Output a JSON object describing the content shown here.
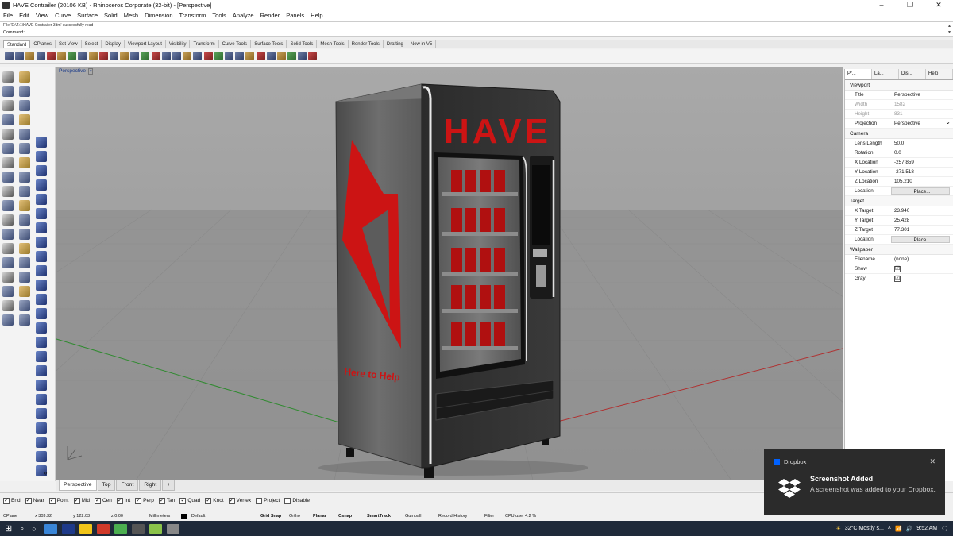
{
  "window": {
    "title": "HAVE Contrailer (20106 KB) - Rhinoceros Corporate (32-bit) - [Perspective]"
  },
  "menu": [
    "File",
    "Edit",
    "View",
    "Curve",
    "Surface",
    "Solid",
    "Mesh",
    "Dimension",
    "Transform",
    "Tools",
    "Analyze",
    "Render",
    "Panels",
    "Help"
  ],
  "command": {
    "history": "File 'E:\\Z:1\\HAVE Contrailer 3dm' successfully read",
    "prompt": "Command:"
  },
  "toolbar_tabs": [
    "Standard",
    "CPlanes",
    "Set View",
    "Select",
    "Display",
    "Viewport Layout",
    "Visibility",
    "Transform",
    "Curve Tools",
    "Surface Tools",
    "Solid Tools",
    "Mesh Tools",
    "Render Tools",
    "Drafting",
    "New in V5"
  ],
  "viewport": {
    "label": "Perspective",
    "tabs": [
      "Perspective",
      "Top",
      "Front",
      "Right"
    ],
    "add_tab": "+",
    "model_text": {
      "brand": "HAVE",
      "tagline": "Here to Help"
    }
  },
  "properties": {
    "tabs": [
      "Pr...",
      "La...",
      "Dis...",
      "Help"
    ],
    "sections": {
      "viewport": "Viewport",
      "camera": "Camera",
      "target": "Target",
      "wallpaper": "Wallpaper"
    },
    "viewport_rows": [
      {
        "k": "Title",
        "v": "Perspective"
      },
      {
        "k": "Width",
        "v": "1582"
      },
      {
        "k": "Height",
        "v": "831"
      },
      {
        "k": "Projection",
        "v": "Perspective"
      }
    ],
    "camera_rows": [
      {
        "k": "Lens Length",
        "v": "50.0"
      },
      {
        "k": "Rotation",
        "v": "0.0"
      },
      {
        "k": "X Location",
        "v": "-257.859"
      },
      {
        "k": "Y Location",
        "v": "-271.518"
      },
      {
        "k": "Z Location",
        "v": "105.210"
      },
      {
        "k": "Location",
        "v": "Place..."
      }
    ],
    "target_rows": [
      {
        "k": "X Target",
        "v": "23.940"
      },
      {
        "k": "Y Target",
        "v": "25.428"
      },
      {
        "k": "Z Target",
        "v": "77.301"
      },
      {
        "k": "Location",
        "v": "Place..."
      }
    ],
    "wallpaper_rows": [
      {
        "k": "Filename",
        "v": "(none)"
      },
      {
        "k": "Show",
        "v": "☑"
      },
      {
        "k": "Gray",
        "v": "☑"
      }
    ]
  },
  "osnaps": [
    {
      "label": "End",
      "checked": true
    },
    {
      "label": "Near",
      "checked": true
    },
    {
      "label": "Point",
      "checked": true
    },
    {
      "label": "Mid",
      "checked": true
    },
    {
      "label": "Cen",
      "checked": true
    },
    {
      "label": "Int",
      "checked": true
    },
    {
      "label": "Perp",
      "checked": true
    },
    {
      "label": "Tan",
      "checked": true
    },
    {
      "label": "Quad",
      "checked": true
    },
    {
      "label": "Knot",
      "checked": true
    },
    {
      "label": "Vertex",
      "checked": true
    },
    {
      "label": "Project",
      "checked": false
    },
    {
      "label": "Disable",
      "checked": false
    }
  ],
  "status": {
    "cplane": "CPlane",
    "x": "x 303.32",
    "y": "y 122.03",
    "z": "z 0.00",
    "units": "Millimeters",
    "layer": "Default",
    "grid_snap": "Grid Snap",
    "ortho": "Ortho",
    "planar": "Planar",
    "osnap": "Osnap",
    "smarttrack": "SmartTrack",
    "gumball": "Gumball",
    "record_history": "Record History",
    "filter": "Filter",
    "cpu": "CPU use: 4.2 %"
  },
  "toast": {
    "app": "Dropbox",
    "title": "Screenshot Added",
    "message": "A screenshot was added to your Dropbox."
  },
  "tray": {
    "weather": "32°C  Mostly s...",
    "time": "9:52 AM"
  },
  "colors": {
    "viewport_bg": "#9a9a9a",
    "accent_red": "#cc1414",
    "taskbar": "#1f2a3a"
  }
}
